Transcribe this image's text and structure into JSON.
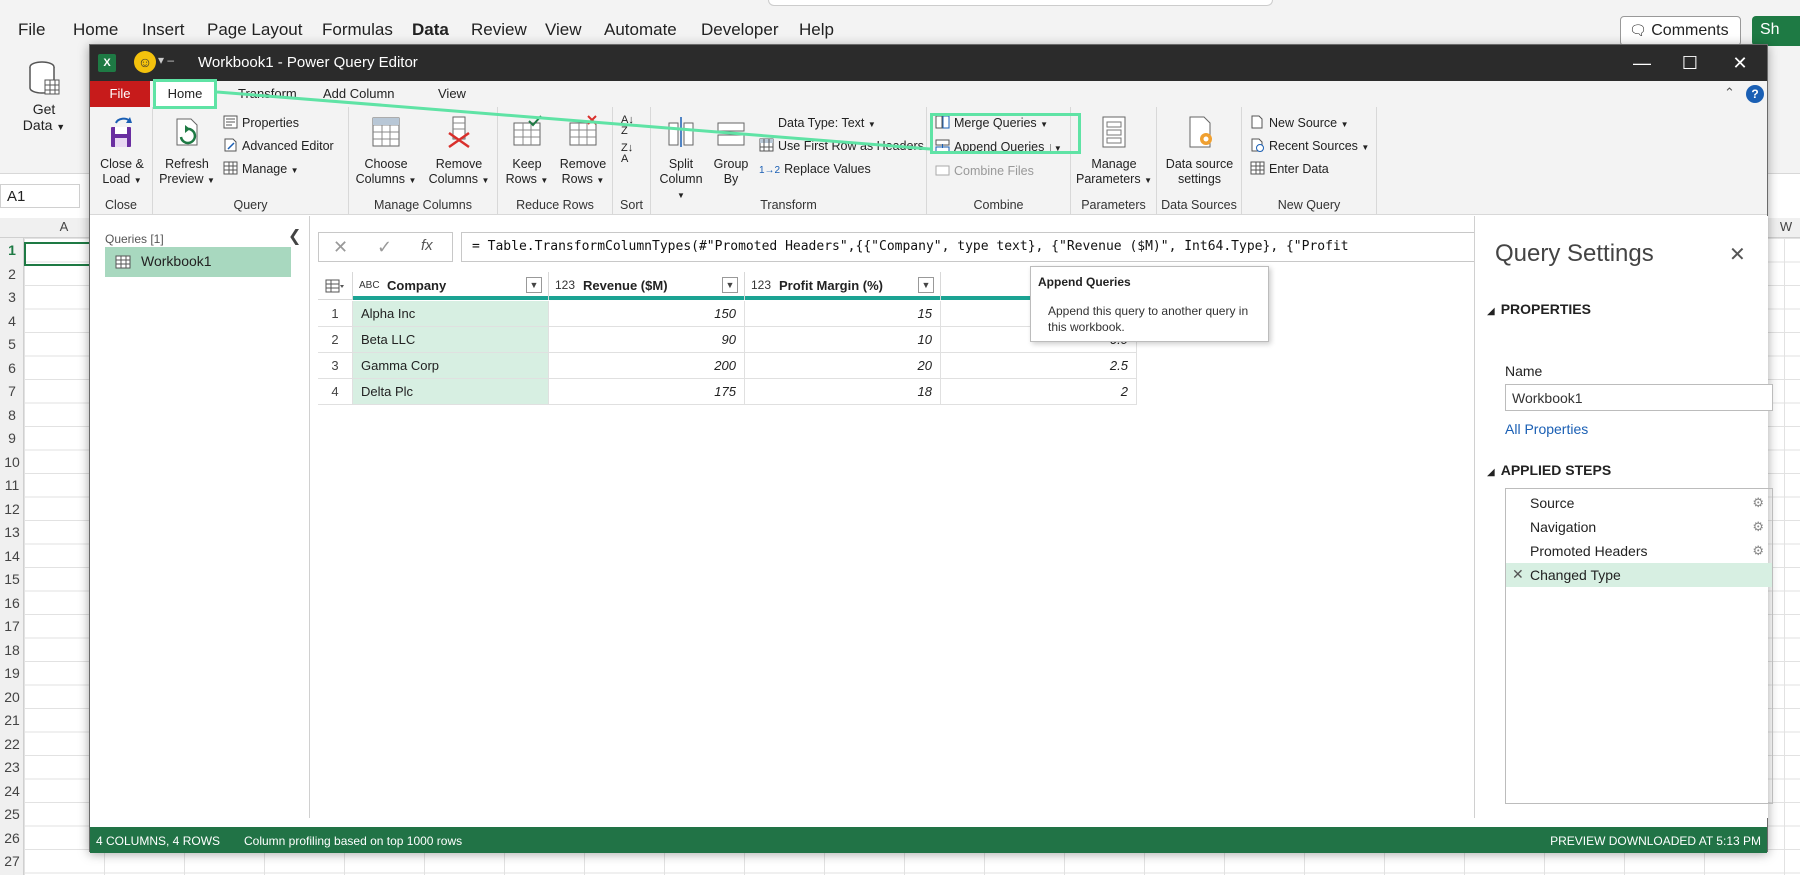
{
  "excel": {
    "menu": [
      "File",
      "Home",
      "Insert",
      "Page Layout",
      "Formulas",
      "Data",
      "Review",
      "View",
      "Automate",
      "Developer",
      "Help"
    ],
    "active_menu": "Data",
    "comments_label": "Comments",
    "share_label": "Sh",
    "get_data_label_1": "Get",
    "get_data_label_2": "Data",
    "name_box": "A1",
    "column_a": "A",
    "column_w": "W",
    "rows": [
      "1",
      "2",
      "3",
      "4",
      "5",
      "6",
      "7",
      "8",
      "9",
      "10",
      "11",
      "12",
      "13",
      "14",
      "15",
      "16",
      "17",
      "18",
      "19",
      "20",
      "21",
      "22",
      "23",
      "24",
      "25",
      "26",
      "27"
    ]
  },
  "pq": {
    "window_title": "Workbook1 - Power Query Editor",
    "tabs": {
      "file": "File",
      "home": "Home",
      "transform": "Transform",
      "add_column": "Add Column",
      "view": "View"
    },
    "ribbon": {
      "close": {
        "label_1": "Close &",
        "label_2": "Load",
        "group": "Close"
      },
      "query": {
        "refresh_1": "Refresh",
        "refresh_2": "Preview",
        "properties": "Properties",
        "advanced_editor": "Advanced Editor",
        "manage": "Manage",
        "group": "Query"
      },
      "manage_columns": {
        "choose_1": "Choose",
        "choose_2": "Columns",
        "remove_1": "Remove",
        "remove_2": "Columns",
        "group": "Manage Columns"
      },
      "reduce_rows": {
        "keep_1": "Keep",
        "keep_2": "Rows",
        "remove_1": "Remove",
        "remove_2": "Rows",
        "group": "Reduce Rows"
      },
      "sort": {
        "group": "Sort"
      },
      "transform": {
        "split_1": "Split",
        "split_2": "Column",
        "group_1": "Group",
        "group_2": "By",
        "data_type": "Data Type: Text",
        "first_row": "Use First Row as Headers",
        "replace": "Replace Values",
        "group": "Transform"
      },
      "combine": {
        "merge": "Merge Queries",
        "append": "Append Queries",
        "combine_files": "Combine Files",
        "group": "Combine"
      },
      "parameters": {
        "manage_1": "Manage",
        "manage_2": "Parameters",
        "group": "Parameters"
      },
      "data_sources": {
        "settings_1": "Data source",
        "settings_2": "settings",
        "group": "Data Sources"
      },
      "new_query": {
        "new_source": "New Source",
        "recent_sources": "Recent Sources",
        "enter_data": "Enter Data",
        "group": "New Query"
      }
    },
    "queries": {
      "label": "Queries [1]",
      "items": [
        "Workbook1"
      ]
    },
    "formula": "= Table.TransformColumnTypes(#\"Promoted Headers\",{{\"Company\", type text}, {\"Revenue ($M)\", Int64.Type}, {\"Profit",
    "fx": "fx",
    "columns": [
      {
        "type": "ABC",
        "name": "Company"
      },
      {
        "type": "123",
        "name": "Revenue ($M)"
      },
      {
        "type": "123",
        "name": "Profit Margin (%)"
      },
      {
        "type": "",
        "name": ""
      }
    ],
    "rows": [
      {
        "n": "1",
        "company": "Alpha Inc",
        "revenue": "150",
        "margin": "15",
        "c4": "1.5"
      },
      {
        "n": "2",
        "company": "Beta LLC",
        "revenue": "90",
        "margin": "10",
        "c4": "0.9"
      },
      {
        "n": "3",
        "company": "Gamma Corp",
        "revenue": "200",
        "margin": "20",
        "c4": "2.5"
      },
      {
        "n": "4",
        "company": "Delta Plc",
        "revenue": "175",
        "margin": "18",
        "c4": "2"
      }
    ],
    "tooltip": {
      "title": "Append Queries",
      "description": "Append this query to another query in this workbook."
    },
    "settings": {
      "title": "Query Settings",
      "properties_label": "PROPERTIES",
      "name_label": "Name",
      "name_value": "Workbook1",
      "all_properties": "All Properties",
      "applied_steps_label": "APPLIED STEPS",
      "steps": [
        "Source",
        "Navigation",
        "Promoted Headers",
        "Changed Type"
      ]
    },
    "status": {
      "left": "4 COLUMNS, 4 ROWS",
      "profiling": "Column profiling based on top 1000 rows",
      "right": "PREVIEW DOWNLOADED AT 5:13 PM"
    },
    "colors": {
      "file_tab": "#c71b1b",
      "status_bar": "#217346",
      "highlight": "#5fe3a5",
      "selected_fill": "#d7efe2"
    }
  }
}
